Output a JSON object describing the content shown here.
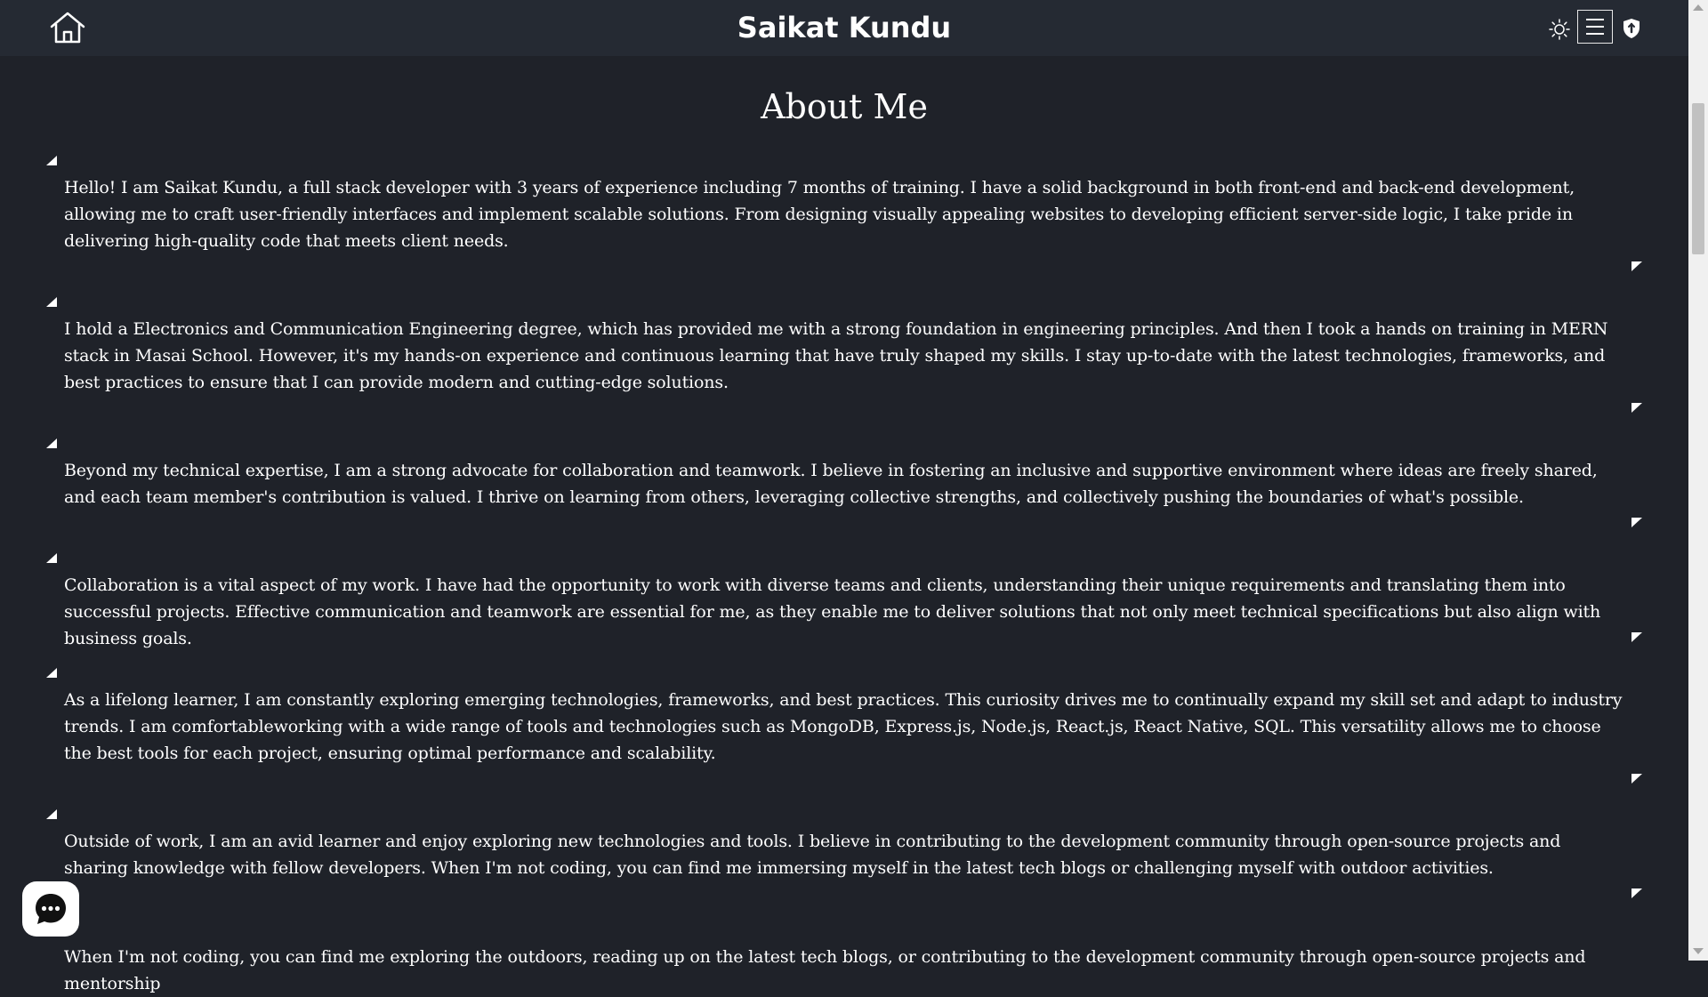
{
  "header": {
    "brand": "Saikat Kundu",
    "icons": {
      "home": "home-icon",
      "theme": "sun-icon",
      "menu": "hamburger-menu-icon",
      "shield": "shield-icon"
    }
  },
  "main": {
    "title": "About Me",
    "paragraphs": [
      "Hello! I am Saikat Kundu, a full stack developer with 3 years of experience including 7 months of training. I have a solid background in both front-end and back-end development, allowing me to craft user-friendly interfaces and implement scalable solutions. From designing visually appealing websites to developing efficient server-side logic, I take pride in delivering high-quality code that meets client needs.",
      "I hold a Electronics and Communication Engineering degree, which has provided me with a strong foundation in engineering principles. And then I took a hands on training in MERN stack in Masai School. However, it's my hands-on experience and continuous learning that have truly shaped my skills. I stay up-to-date with the latest technologies, frameworks, and best practices to ensure that I can provide modern and cutting-edge solutions.",
      "Beyond my technical expertise, I am a strong advocate for collaboration and teamwork. I believe in fostering an inclusive and supportive environment where ideas are freely shared, and each team member's contribution is valued. I thrive on learning from others, leveraging collective strengths, and collectively pushing the boundaries of what's possible.",
      "Collaboration is a vital aspect of my work. I have had the opportunity to work with diverse teams and clients, understanding their unique requirements and translating them into successful projects. Effective communication and teamwork are essential for me, as they enable me to deliver solutions that not only meet technical specifications but also align with business goals.",
      "As a lifelong learner, I am constantly exploring emerging technologies, frameworks, and best practices. This curiosity drives me to continually expand my skill set and adapt to industry trends. I am comfortableworking with a wide range of tools and technologies such as MongoDB, Express.js, Node.js, React.js, React Native, SQL. This versatility allows me to choose the best tools for each project, ensuring optimal performance and scalability.",
      "Outside of work, I am an avid learner and enjoy exploring new technologies and tools. I believe in contributing to the development community through open-source projects and sharing knowledge with fellow developers. When I'm not coding, you can find me immersing myself in the latest tech blogs or challenging myself with outdoor activities.",
      "When I'm not coding, you can find me exploring the outdoors, reading up on the latest tech blogs, or contributing to the development community through open-source projects and mentorship"
    ]
  },
  "chat": {
    "icon": "chat-bubble-icon"
  },
  "colors": {
    "background": "#1f2229",
    "header": "#252a33",
    "text": "#ffffff"
  }
}
